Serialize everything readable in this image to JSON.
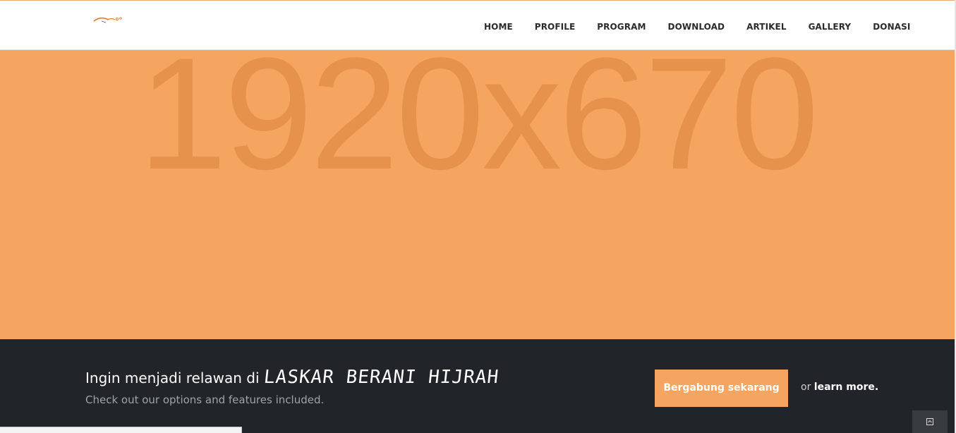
{
  "header": {
    "logo_icon": "bird-logo",
    "accent_color": "#f5a560",
    "nav": {
      "items": [
        {
          "label": "HOME"
        },
        {
          "label": "PROFILE"
        },
        {
          "label": "PROGRAM"
        },
        {
          "label": "DOWNLOAD"
        },
        {
          "label": "ARTIKEL"
        },
        {
          "label": "GALLERY"
        },
        {
          "label": "DONASI"
        }
      ]
    }
  },
  "hero": {
    "placeholder_text": "1920x670",
    "background_color": "#f5a560"
  },
  "cta": {
    "heading_prefix": "Ingin menjadi relawan di",
    "heading_brand": "LASKAR BERANI HIJRAH",
    "subtext": "Check out our options and features included.",
    "button_label": "Bergabung sekarang",
    "or_text": "or",
    "learn_more_label": "learn more.",
    "background_color": "#212428"
  },
  "back_to_top": {
    "icon": "back-to-top-icon"
  }
}
